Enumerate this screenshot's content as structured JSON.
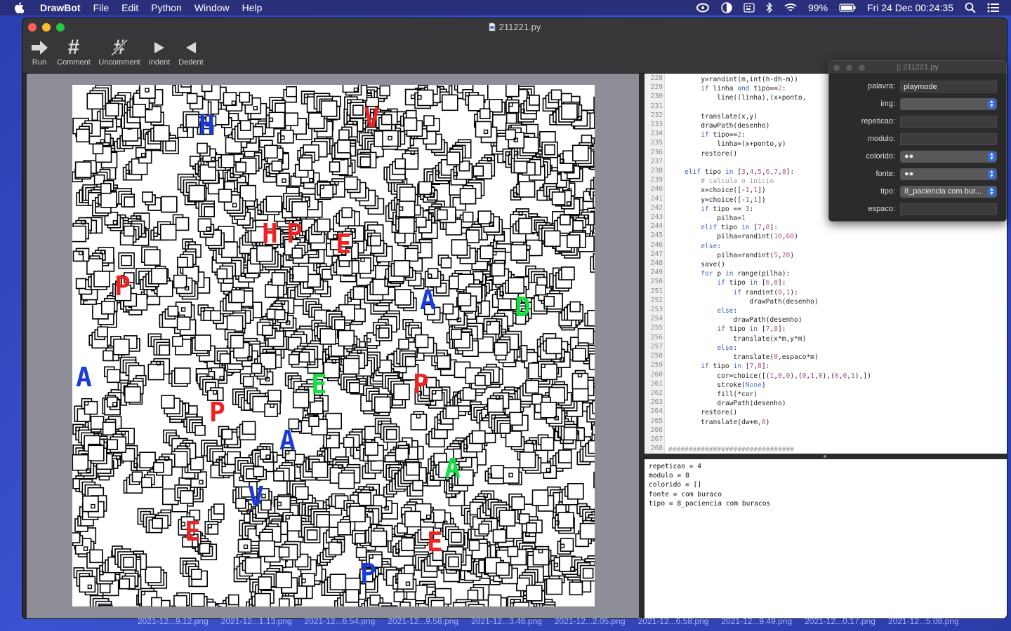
{
  "menubar": {
    "app_name": "DrawBot",
    "items": [
      "File",
      "Edit",
      "Python",
      "Window",
      "Help"
    ],
    "battery": "99%",
    "clock": "Fri 24 Dec  00:24:35"
  },
  "window": {
    "title": "211221.py",
    "toolbar": [
      {
        "label": "Run",
        "icon": "arrow-right-icon"
      },
      {
        "label": "Comment",
        "icon": "hash-icon"
      },
      {
        "label": "Uncomment",
        "icon": "uncomment-icon"
      },
      {
        "label": "Indent",
        "icon": "triangle-right-icon"
      },
      {
        "label": "Dedent",
        "icon": "triangle-left-icon"
      }
    ]
  },
  "editor": {
    "line_numbers": [
      "228",
      "229",
      "230",
      "231",
      "232",
      "233",
      "234",
      "235",
      "236",
      "237",
      "238",
      "239",
      "240",
      "241",
      "242",
      "243",
      "244",
      "245",
      "246",
      "247",
      "248",
      "249",
      "250",
      "251",
      "252",
      "253",
      "254",
      "255",
      "256",
      "257",
      "258",
      "259",
      "260",
      "261",
      "262",
      "263",
      "264",
      "265",
      "266",
      "267",
      "268"
    ],
    "code": [
      "        y=randint(m,int(h-dh-m))",
      "        if linha and tipo==2:",
      "            line((linha),(x+ponto,",
      "",
      "        translate(x,y)",
      "        drawPath(desenho)",
      "        if tipo==2:",
      "            linha=(x+ponto,y)",
      "        restore()",
      "",
      "    elif tipo in [3,4,5,6,7,8]:",
      "        # calcula o inicio",
      "        x=choice([-1,1])",
      "        y=choice([-1,1])",
      "        if tipo == 3:",
      "            pilha=1",
      "        elif tipo in [7,8]:",
      "            pilha=randint(10,60)",
      "        else:",
      "            pilha=randint(5,20)",
      "        save()",
      "        for p in range(pilha):",
      "            if tipo in [6,8]:",
      "                if randint(0,1):",
      "                    drawPath(desenho)",
      "            else:",
      "                drawPath(desenho)",
      "            if tipo in [7,8]:",
      "                translate(x*m,y*m)",
      "            else:",
      "                translate(0,espaco*m)",
      "        if tipo in [7,8]:",
      "            cor=choice([(1,0,0),(0,1,0),(0,0,1),])",
      "            stroke(None)",
      "            fill(*cor)",
      "            drawPath(desenho)",
      "        restore()",
      "        translate(dw+m,0)",
      "",
      "",
      "###############################"
    ]
  },
  "output": {
    "lines": [
      "repeticao = 4",
      "modulo = 8",
      "colorido = []",
      "fonte = com buraco",
      "tipo = 8_paciencia com buracos"
    ]
  },
  "variables": {
    "title": "211221.py",
    "rows": [
      {
        "label": "palavra:",
        "kind": "field",
        "value": "playmode"
      },
      {
        "label": "img:",
        "kind": "select",
        "value": ""
      },
      {
        "label": "repeticao:",
        "kind": "field",
        "value": ""
      },
      {
        "label": "modulo:",
        "kind": "field",
        "value": ""
      },
      {
        "label": "colorido:",
        "kind": "select",
        "value": "●●"
      },
      {
        "label": "fonte:",
        "kind": "select",
        "value": "●●"
      },
      {
        "label": "tipo:",
        "kind": "select",
        "value": "8_paciencia com bur..."
      },
      {
        "label": "espaco:",
        "kind": "field",
        "value": ""
      }
    ]
  },
  "desktop_files": [
    "2021-12...9.12.png",
    "2021-12...1.13.png",
    "2021-12...6.54.png",
    "2021-12...9.58.png",
    "2021-12...3.46.png",
    "2021-12...2.05.png",
    "2021-12...6.58.png",
    "2021-12...9.49.png",
    "2021-12...0.17.png",
    "2021-12...5.08.png"
  ],
  "artwork": {
    "letter_colors": {
      "red": "#ee2222",
      "green": "#10e040",
      "blue": "#1a3bdc"
    },
    "letters": [
      {
        "char": "H",
        "color": "red"
      },
      {
        "char": "P",
        "color": "red"
      },
      {
        "char": "E",
        "color": "red"
      },
      {
        "char": "A",
        "color": "blue"
      },
      {
        "char": "D",
        "color": "green"
      },
      {
        "char": "P",
        "color": "red"
      },
      {
        "char": "E",
        "color": "green"
      },
      {
        "char": "P",
        "color": "red"
      },
      {
        "char": "A",
        "color": "blue"
      },
      {
        "char": "A",
        "color": "green"
      },
      {
        "char": "V",
        "color": "blue"
      },
      {
        "char": "E",
        "color": "red"
      },
      {
        "char": "E",
        "color": "red"
      },
      {
        "char": "P",
        "color": "blue"
      },
      {
        "char": "A",
        "color": "blue"
      },
      {
        "char": "P",
        "color": "red"
      },
      {
        "char": "H",
        "color": "blue"
      },
      {
        "char": "V",
        "color": "red"
      }
    ]
  }
}
